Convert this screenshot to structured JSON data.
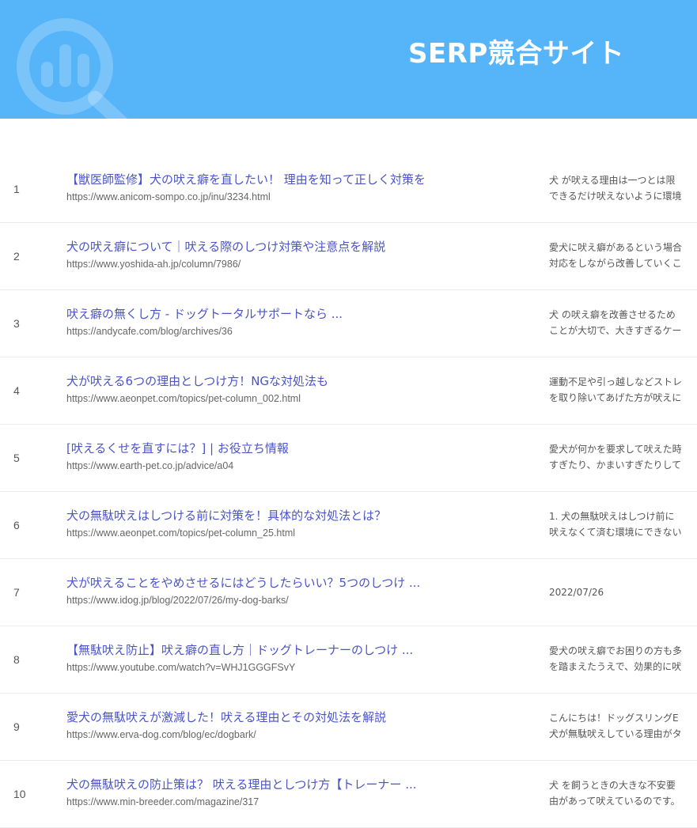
{
  "header": {
    "title": "SERP競合サイト",
    "icon": "analytics-search-icon",
    "bg_color": "#56b4f8"
  },
  "results": [
    {
      "rank": "1",
      "title": "【獣医師監修】犬の吠え癖を直したい！ 理由を知って正しく対策を",
      "url": "https://www.anicom-sompo.co.jp/inu/3234.html",
      "snippet": [
        "犬 が吠える理由は一つとは限",
        "できるだけ吠えないように環境"
      ]
    },
    {
      "rank": "2",
      "title": "犬の吠え癖について｜吠える際のしつけ対策や注意点を解説",
      "url": "https://www.yoshida-ah.jp/column/7986/",
      "snippet": [
        "愛犬に吠え癖があるという場合",
        "対応をしながら改善していくこ"
      ]
    },
    {
      "rank": "3",
      "title": "吠え癖の無くし方 - ドッグトータルサポートなら ...",
      "url": "https://andycafe.com/blog/archives/36",
      "snippet": [
        "犬 の吠え癖を改善させるため",
        "ことが大切で、大きすぎるケー"
      ]
    },
    {
      "rank": "4",
      "title": "犬が吠える6つの理由としつけ方！NGな対処法も",
      "url": "https://www.aeonpet.com/topics/pet-column_002.html",
      "snippet": [
        "運動不足や引っ越しなどストレ",
        "を取り除いてあげた方が吠えに"
      ]
    },
    {
      "rank": "5",
      "title": "[吠えるくせを直すには？] | お役立ち情報",
      "url": "https://www.earth-pet.co.jp/advice/a04",
      "snippet": [
        "愛犬が何かを要求して吠えた時",
        "すぎたり、かまいすぎたりして"
      ]
    },
    {
      "rank": "6",
      "title": "犬の無駄吠えはしつける前に対策を！具体的な対処法とは？",
      "url": "https://www.aeonpet.com/topics/pet-column_25.html",
      "snippet": [
        "1. 犬の無駄吠えはしつけ前に",
        "吠えなくて済む環境にできない"
      ]
    },
    {
      "rank": "7",
      "title": "犬が吠えることをやめさせるにはどうしたらいい？5つのしつけ ...",
      "url": "https://www.idog.jp/blog/2022/07/26/my-dog-barks/",
      "snippet": [
        "2022/07/26"
      ]
    },
    {
      "rank": "8",
      "title": "【無駄吠え防止】吠え癖の直し方｜ドッグトレーナーのしつけ ...",
      "url": "https://www.youtube.com/watch?v=WHJ1GGGFSvY",
      "snippet": [
        "愛犬の吠え癖でお困りの方も多",
        "を踏まえたうえで、効果的に吠"
      ]
    },
    {
      "rank": "9",
      "title": "愛犬の無駄吠えが激減した！吠える理由とその対処法を解説",
      "url": "https://www.erva-dog.com/blog/ec/dogbark/",
      "snippet": [
        "こんにちは！ドッグスリングE",
        "犬が無駄吠えしている理由がタ"
      ]
    },
    {
      "rank": "10",
      "title": "犬の無駄吠えの防止策は？ 吠える理由としつけ方【トレーナー ...",
      "url": "https://www.min-breeder.com/magazine/317",
      "snippet": [
        "犬 を飼うときの大きな不安要",
        "由があって吠えているのです。"
      ]
    }
  ]
}
